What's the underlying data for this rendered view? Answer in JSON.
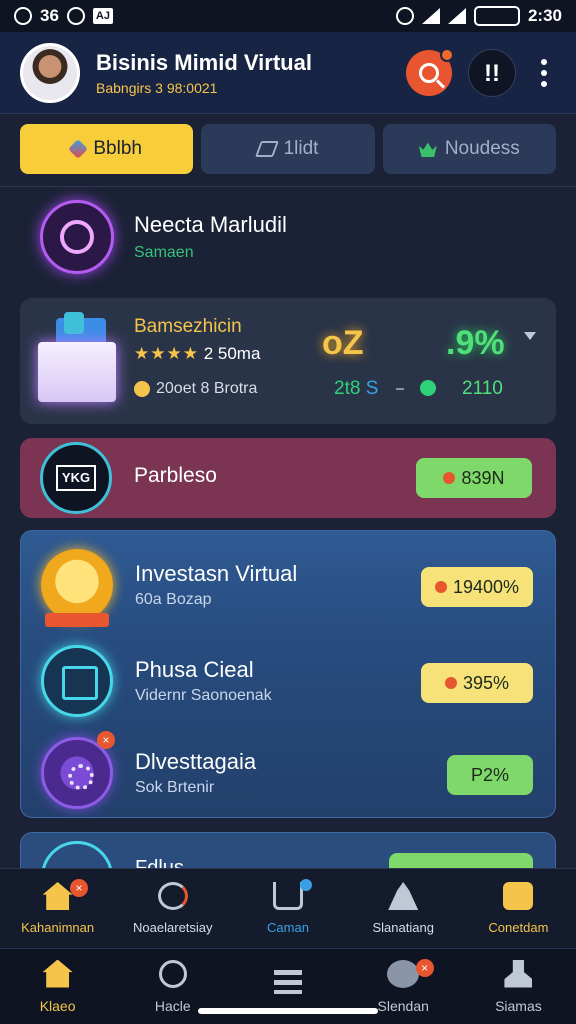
{
  "status_bar": {
    "left": "36",
    "right_time": "2:30",
    "box_label": "AJ"
  },
  "header": {
    "title": "Bisinis Mimid Virtual",
    "subtitle": "Babngirs 3 98:0021",
    "alert_label": "!!",
    "colors": {
      "accent": "#f4c54a",
      "search": "#e8552f"
    }
  },
  "tabs": [
    {
      "label": "Bblbh",
      "active": true
    },
    {
      "label": "1lidt",
      "active": false
    },
    {
      "label": "Noudess",
      "active": false
    }
  ],
  "profile": {
    "title": "Neecta Marludil",
    "subtitle": "Samaen"
  },
  "card_stats": {
    "title": "Bamsezhicin",
    "stars": "★★★★",
    "rating": "2 50ma",
    "meta": "20oet 8 Brotra",
    "big_value_1": "oZ",
    "big_value_2": ".9%",
    "value_1": "2t8",
    "value_1_suffix": "S",
    "value_2": "2110"
  },
  "card_featured": {
    "title": "Parbleso",
    "logo_text": "YKG",
    "pill": "839N"
  },
  "investments": [
    {
      "title": "Investasn Virtual",
      "subtitle": "60a Bozap",
      "value": "19400%",
      "pill": "yellow"
    },
    {
      "title": "Phusa Cieal",
      "subtitle": "Vidernr Saonoenak",
      "value": "395%",
      "pill": "yellow"
    },
    {
      "title": "Dlvesttagaia",
      "subtitle": "Sok Brtenir",
      "value": "P2%",
      "pill": "green"
    }
  ],
  "peek_card": {
    "title": "Fdlus"
  },
  "nav_top": [
    {
      "label": "Kahanimnan",
      "icon": "home-icon",
      "active": true
    },
    {
      "label": "Noaelaretsiay",
      "icon": "clock-icon",
      "active": false
    },
    {
      "label": "Caman",
      "icon": "cart-icon",
      "active": false
    },
    {
      "label": "Slanatiang",
      "icon": "user-group-icon",
      "active": false
    },
    {
      "label": "Conetdam",
      "icon": "gift-icon",
      "active": false
    }
  ],
  "nav_bottom": [
    {
      "label": "Klaeo",
      "icon": "home-icon",
      "active": true
    },
    {
      "label": "Hacle",
      "icon": "search-icon",
      "active": false
    },
    {
      "label": "",
      "icon": "menu-icon",
      "active": false
    },
    {
      "label": "Slendan",
      "icon": "chat-icon",
      "active": false
    },
    {
      "label": "Siamas",
      "icon": "person-icon",
      "active": false
    }
  ]
}
